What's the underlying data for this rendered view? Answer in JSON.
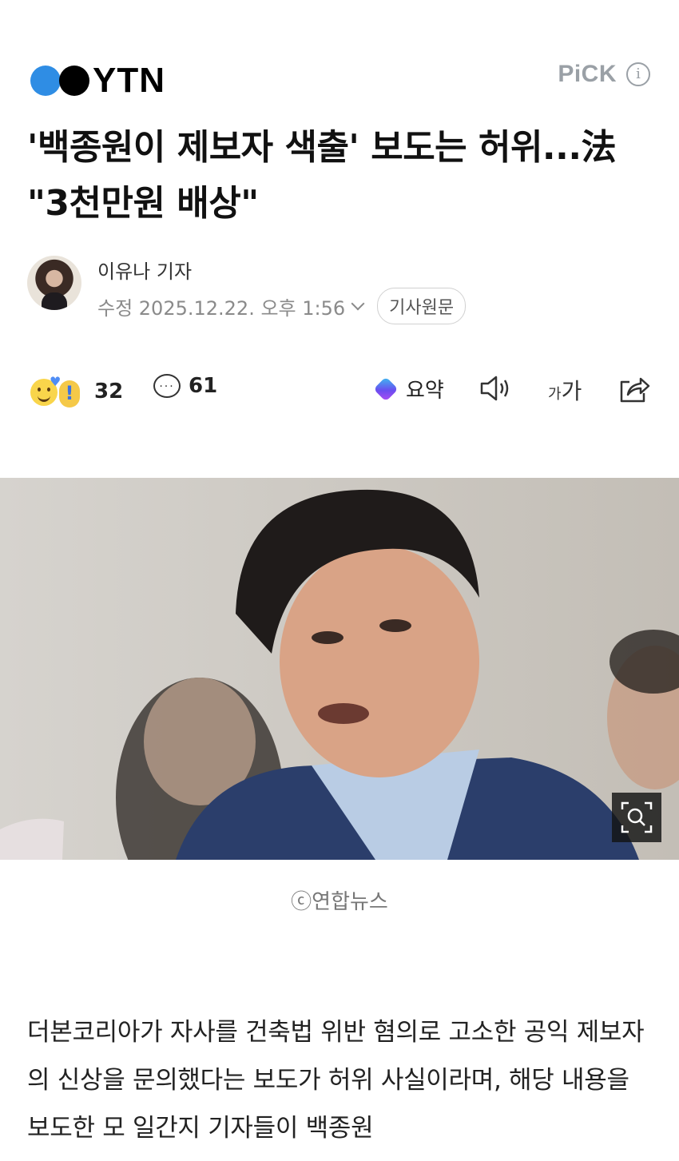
{
  "header": {
    "logo_text": "YTN",
    "pick_label": "PiCK",
    "info_icon": "info-icon"
  },
  "article": {
    "headline": "'백종원이 제보자 색출' 보도는 허위...法 \"3천만원 배상\"",
    "reporter": "이유나 기자",
    "date": "수정 2025.12.22. 오후 1:56",
    "original_button": "기사원문"
  },
  "toolbar": {
    "reaction_count": "32",
    "comment_count": "61",
    "summary_label": "요약",
    "font_small": "가",
    "font_large": "가",
    "icons": [
      "reaction-emoji-icon",
      "comment-icon",
      "ai-summary-icon",
      "speaker-icon",
      "font-size-icon",
      "share-icon"
    ]
  },
  "photo": {
    "caption": "ⓒ연합뉴스",
    "zoom_icon": "zoom-icon"
  },
  "body": {
    "paragraph": "더본코리아가 자사를 건축법 위반 혐의로 고소한 공익 제보자의 신상을 문의했다는 보도가 허위 사실이라며, 해당 내용을 보도한 모 일간지 기자들이 백종원"
  },
  "colors": {
    "brand_blue": "#2f8de4",
    "text": "#111111",
    "muted": "#8a8a8a"
  }
}
